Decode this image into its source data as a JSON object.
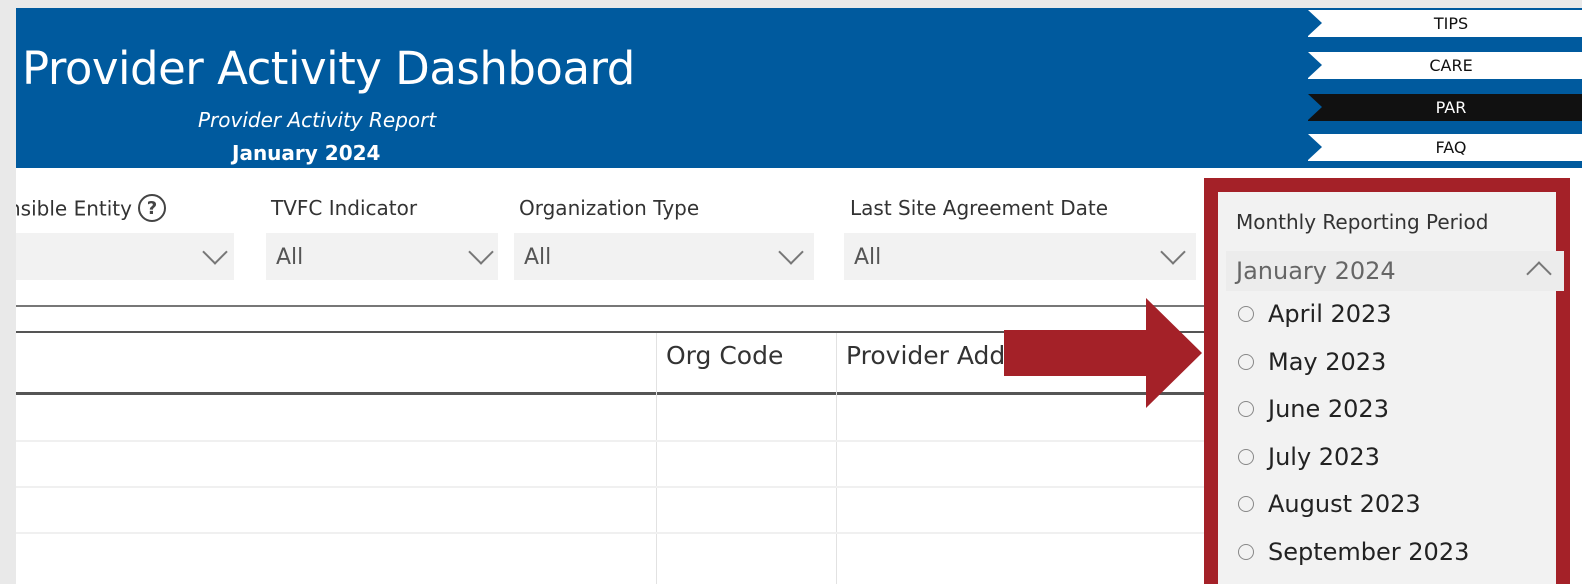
{
  "header": {
    "title": "Provider Activity Dashboard",
    "subtitle": "Provider Activity Report",
    "period": "January 2024",
    "nav": [
      {
        "label": "TIPS",
        "active": false
      },
      {
        "label": "CARE",
        "active": false
      },
      {
        "label": "PAR",
        "active": true
      },
      {
        "label": "FAQ",
        "active": false
      }
    ]
  },
  "filters": {
    "responsible_entity_label": "nsible Entity",
    "tvfc_label": "TVFC Indicator",
    "tvfc_value": "All",
    "org_type_label": "Organization Type",
    "org_type_value": "All",
    "site_agreement_label": "Last Site Agreement Date",
    "site_agreement_value": "All",
    "reporting_period_label": "Monthly Reporting Period",
    "reporting_period_value": "January 2024",
    "reporting_period_options": [
      "April 2023",
      "May 2023",
      "June 2023",
      "July 2023",
      "August 2023",
      "September 2023"
    ]
  },
  "table": {
    "columns": [
      "Org Code",
      "Provider Add"
    ]
  },
  "colors": {
    "banner": "#005a9e",
    "highlight": "#a42128",
    "active_nav": "#111111"
  },
  "icons": {
    "help": "help-icon",
    "annotation_arrow": "arrow-right-icon"
  }
}
